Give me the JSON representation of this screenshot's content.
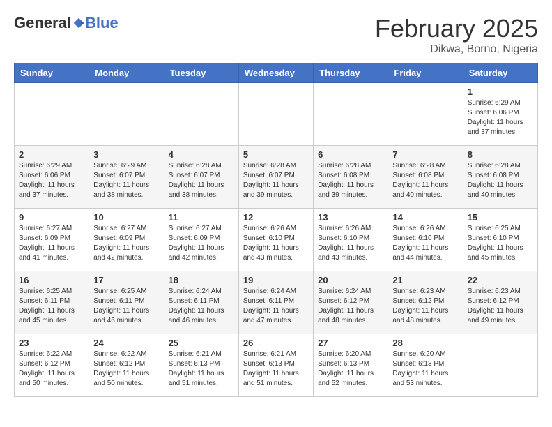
{
  "header": {
    "logo_general": "General",
    "logo_blue": "Blue",
    "month_title": "February 2025",
    "location": "Dikwa, Borno, Nigeria"
  },
  "weekdays": [
    "Sunday",
    "Monday",
    "Tuesday",
    "Wednesday",
    "Thursday",
    "Friday",
    "Saturday"
  ],
  "weeks": [
    [
      {
        "day": "",
        "sunrise": "",
        "sunset": "",
        "daylight": ""
      },
      {
        "day": "",
        "sunrise": "",
        "sunset": "",
        "daylight": ""
      },
      {
        "day": "",
        "sunrise": "",
        "sunset": "",
        "daylight": ""
      },
      {
        "day": "",
        "sunrise": "",
        "sunset": "",
        "daylight": ""
      },
      {
        "day": "",
        "sunrise": "",
        "sunset": "",
        "daylight": ""
      },
      {
        "day": "",
        "sunrise": "",
        "sunset": "",
        "daylight": ""
      },
      {
        "day": "1",
        "sunrise": "Sunrise: 6:29 AM",
        "sunset": "Sunset: 6:06 PM",
        "daylight": "Daylight: 11 hours and 37 minutes."
      }
    ],
    [
      {
        "day": "2",
        "sunrise": "Sunrise: 6:29 AM",
        "sunset": "Sunset: 6:06 PM",
        "daylight": "Daylight: 11 hours and 37 minutes."
      },
      {
        "day": "3",
        "sunrise": "Sunrise: 6:29 AM",
        "sunset": "Sunset: 6:07 PM",
        "daylight": "Daylight: 11 hours and 38 minutes."
      },
      {
        "day": "4",
        "sunrise": "Sunrise: 6:28 AM",
        "sunset": "Sunset: 6:07 PM",
        "daylight": "Daylight: 11 hours and 38 minutes."
      },
      {
        "day": "5",
        "sunrise": "Sunrise: 6:28 AM",
        "sunset": "Sunset: 6:07 PM",
        "daylight": "Daylight: 11 hours and 39 minutes."
      },
      {
        "day": "6",
        "sunrise": "Sunrise: 6:28 AM",
        "sunset": "Sunset: 6:08 PM",
        "daylight": "Daylight: 11 hours and 39 minutes."
      },
      {
        "day": "7",
        "sunrise": "Sunrise: 6:28 AM",
        "sunset": "Sunset: 6:08 PM",
        "daylight": "Daylight: 11 hours and 40 minutes."
      },
      {
        "day": "8",
        "sunrise": "Sunrise: 6:28 AM",
        "sunset": "Sunset: 6:08 PM",
        "daylight": "Daylight: 11 hours and 40 minutes."
      }
    ],
    [
      {
        "day": "9",
        "sunrise": "Sunrise: 6:27 AM",
        "sunset": "Sunset: 6:09 PM",
        "daylight": "Daylight: 11 hours and 41 minutes."
      },
      {
        "day": "10",
        "sunrise": "Sunrise: 6:27 AM",
        "sunset": "Sunset: 6:09 PM",
        "daylight": "Daylight: 11 hours and 42 minutes."
      },
      {
        "day": "11",
        "sunrise": "Sunrise: 6:27 AM",
        "sunset": "Sunset: 6:09 PM",
        "daylight": "Daylight: 11 hours and 42 minutes."
      },
      {
        "day": "12",
        "sunrise": "Sunrise: 6:26 AM",
        "sunset": "Sunset: 6:10 PM",
        "daylight": "Daylight: 11 hours and 43 minutes."
      },
      {
        "day": "13",
        "sunrise": "Sunrise: 6:26 AM",
        "sunset": "Sunset: 6:10 PM",
        "daylight": "Daylight: 11 hours and 43 minutes."
      },
      {
        "day": "14",
        "sunrise": "Sunrise: 6:26 AM",
        "sunset": "Sunset: 6:10 PM",
        "daylight": "Daylight: 11 hours and 44 minutes."
      },
      {
        "day": "15",
        "sunrise": "Sunrise: 6:25 AM",
        "sunset": "Sunset: 6:10 PM",
        "daylight": "Daylight: 11 hours and 45 minutes."
      }
    ],
    [
      {
        "day": "16",
        "sunrise": "Sunrise: 6:25 AM",
        "sunset": "Sunset: 6:11 PM",
        "daylight": "Daylight: 11 hours and 45 minutes."
      },
      {
        "day": "17",
        "sunrise": "Sunrise: 6:25 AM",
        "sunset": "Sunset: 6:11 PM",
        "daylight": "Daylight: 11 hours and 46 minutes."
      },
      {
        "day": "18",
        "sunrise": "Sunrise: 6:24 AM",
        "sunset": "Sunset: 6:11 PM",
        "daylight": "Daylight: 11 hours and 46 minutes."
      },
      {
        "day": "19",
        "sunrise": "Sunrise: 6:24 AM",
        "sunset": "Sunset: 6:11 PM",
        "daylight": "Daylight: 11 hours and 47 minutes."
      },
      {
        "day": "20",
        "sunrise": "Sunrise: 6:24 AM",
        "sunset": "Sunset: 6:12 PM",
        "daylight": "Daylight: 11 hours and 48 minutes."
      },
      {
        "day": "21",
        "sunrise": "Sunrise: 6:23 AM",
        "sunset": "Sunset: 6:12 PM",
        "daylight": "Daylight: 11 hours and 48 minutes."
      },
      {
        "day": "22",
        "sunrise": "Sunrise: 6:23 AM",
        "sunset": "Sunset: 6:12 PM",
        "daylight": "Daylight: 11 hours and 49 minutes."
      }
    ],
    [
      {
        "day": "23",
        "sunrise": "Sunrise: 6:22 AM",
        "sunset": "Sunset: 6:12 PM",
        "daylight": "Daylight: 11 hours and 50 minutes."
      },
      {
        "day": "24",
        "sunrise": "Sunrise: 6:22 AM",
        "sunset": "Sunset: 6:12 PM",
        "daylight": "Daylight: 11 hours and 50 minutes."
      },
      {
        "day": "25",
        "sunrise": "Sunrise: 6:21 AM",
        "sunset": "Sunset: 6:13 PM",
        "daylight": "Daylight: 11 hours and 51 minutes."
      },
      {
        "day": "26",
        "sunrise": "Sunrise: 6:21 AM",
        "sunset": "Sunset: 6:13 PM",
        "daylight": "Daylight: 11 hours and 51 minutes."
      },
      {
        "day": "27",
        "sunrise": "Sunrise: 6:20 AM",
        "sunset": "Sunset: 6:13 PM",
        "daylight": "Daylight: 11 hours and 52 minutes."
      },
      {
        "day": "28",
        "sunrise": "Sunrise: 6:20 AM",
        "sunset": "Sunset: 6:13 PM",
        "daylight": "Daylight: 11 hours and 53 minutes."
      },
      {
        "day": "",
        "sunrise": "",
        "sunset": "",
        "daylight": ""
      }
    ]
  ]
}
